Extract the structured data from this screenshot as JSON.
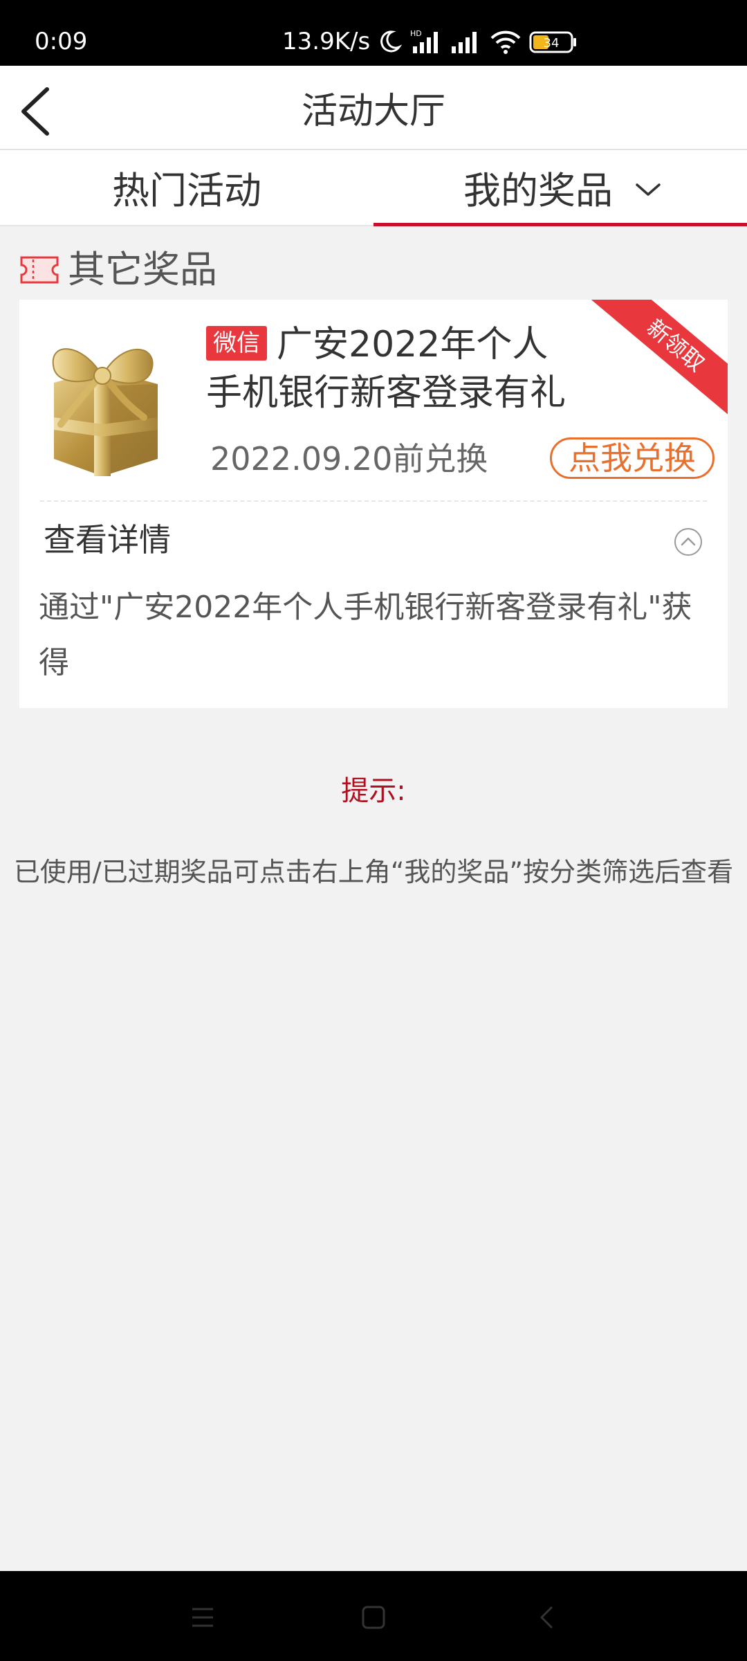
{
  "status_bar": {
    "time": "0:09",
    "net_speed": "13.9K/s",
    "battery_level": "34",
    "icons": [
      "moon-icon",
      "hd-signal-icon",
      "signal-icon",
      "wifi-icon",
      "battery-icon"
    ]
  },
  "header": {
    "title": "活动大厅",
    "back_icon": "chevron-left-icon"
  },
  "tabs": {
    "hot": "热门活动",
    "mine": "我的奖品",
    "active": "mine"
  },
  "section": {
    "title": "其它奖品",
    "icon": "ticket-icon"
  },
  "prize": {
    "ribbon": "新领取",
    "tag": "微信",
    "title_line1": "广安2022年个人",
    "title_line2": "手机银行新客登录有礼",
    "deadline": "2022.09.20前兑换",
    "redeem_label": "点我兑换",
    "detail_label": "查看详情",
    "detail_text": "通过\"广安2022年个人手机银行新客登录有礼\"获得",
    "image": "gift-box-icon"
  },
  "hint": {
    "title": "提示:",
    "text": "已使用/已过期奖品可点击右上角“我的奖品”按分类筛选后查看"
  },
  "nav_bar": {
    "icons": [
      "menu-icon",
      "home-icon",
      "back-icon"
    ]
  },
  "colors": {
    "accent_red": "#c8102e",
    "tag_red": "#e8383d",
    "redeem_orange": "#e8702c",
    "background": "#f2f2f2"
  }
}
